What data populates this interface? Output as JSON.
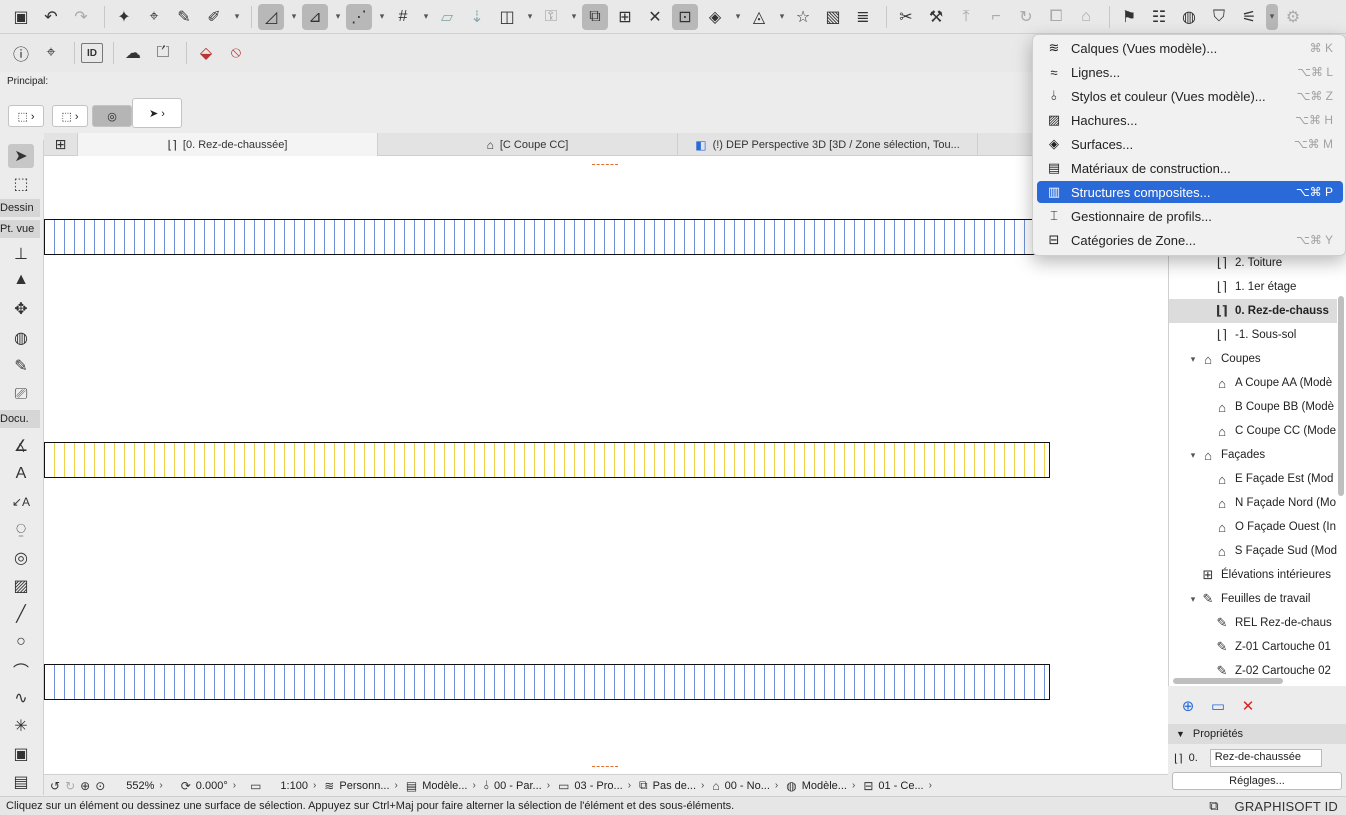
{
  "colors": {
    "menu_highlight": "#2a6ad8",
    "wall_hatch_blue": "#6e8fd8",
    "wall_hatch_yellow": "#f0d24a",
    "marker_orange": "#e07030"
  },
  "principal": {
    "label": "Principal:"
  },
  "toolbox": {
    "groups": {
      "dessin": "Dessin",
      "pt_vue": "Pt. vue",
      "docu": "Docu."
    }
  },
  "tabs": [
    {
      "label": "[0. Rez-de-chaussée]",
      "icon": "floor-plan-icon"
    },
    {
      "label": "[C Coupe CC]",
      "icon": "section-icon"
    },
    {
      "label": "(!) DEP Perspective 3D [3D / Zone sélection, Tou...",
      "icon": "3d-icon"
    }
  ],
  "navigator": {
    "items": [
      {
        "label": "2. Toiture",
        "icon": "floor-plan-icon"
      },
      {
        "label": "1. 1er étage",
        "icon": "floor-plan-icon"
      },
      {
        "label": "0. Rez-de-chauss",
        "icon": "floor-plan-icon"
      },
      {
        "label": "-1. Sous-sol",
        "icon": "floor-plan-icon"
      },
      {
        "label": "Coupes",
        "icon": "section-icon"
      },
      {
        "label": "A Coupe AA (Modè",
        "icon": "section-icon"
      },
      {
        "label": "B Coupe BB (Modè",
        "icon": "section-icon"
      },
      {
        "label": "C Coupe CC (Mode",
        "icon": "section-icon"
      },
      {
        "label": "Façades",
        "icon": "elevation-icon"
      },
      {
        "label": "E Façade Est (Mod",
        "icon": "elevation-icon"
      },
      {
        "label": "N Façade Nord (Mo",
        "icon": "elevation-icon"
      },
      {
        "label": "O Façade Ouest (In",
        "icon": "elevation-icon"
      },
      {
        "label": "S Façade Sud (Mod",
        "icon": "elevation-icon"
      },
      {
        "label": "Élévations intérieures",
        "icon": "interior-elevation-icon"
      },
      {
        "label": "Feuilles de travail",
        "icon": "worksheet-icon"
      },
      {
        "label": "REL Rez-de-chaus",
        "icon": "worksheet-icon"
      },
      {
        "label": "Z-01 Cartouche 01",
        "icon": "worksheet-icon"
      },
      {
        "label": "Z-02 Cartouche 02",
        "icon": "worksheet-icon"
      }
    ]
  },
  "properties": {
    "header": "Propriétés",
    "story_number": "0.",
    "story_name": "Rez-de-chaussée",
    "settings_button": "Réglages..."
  },
  "bottombar": {
    "zoom": "552%",
    "angle": "0.000°",
    "scale": "1:100",
    "layer_combo": "Personn...",
    "model_view": "Modèle...",
    "pen_set": "00 - Par...",
    "renovation": "03 - Pro...",
    "structure": "Pas de...",
    "dimension": "00 - No...",
    "model_view2": "Modèle...",
    "sheet": "01 - Ce..."
  },
  "status": {
    "text": "Cliquez sur un élément ou dessinez une surface de sélection. Appuyez sur Ctrl+Maj pour faire alterner la sélection de l'élément et des sous-éléments.",
    "brand": "GRAPHISOFT ID"
  },
  "menu": {
    "items": [
      {
        "label": "Calques (Vues modèle)...",
        "shortcut": "⌘ K",
        "icon": "layers-icon"
      },
      {
        "label": "Lignes...",
        "shortcut": "⌥⌘ L",
        "icon": "lines-icon"
      },
      {
        "label": "Stylos et couleur (Vues modèle)...",
        "shortcut": "⌥⌘ Z",
        "icon": "pen-icon"
      },
      {
        "label": "Hachures...",
        "shortcut": "⌥⌘ H",
        "icon": "hatch-icon"
      },
      {
        "label": "Surfaces...",
        "shortcut": "⌥⌘ M",
        "icon": "surfaces-icon"
      },
      {
        "label": "Matériaux de construction...",
        "shortcut": "",
        "icon": "building-materials-icon"
      },
      {
        "label": "Structures composites...",
        "shortcut": "⌥⌘ P",
        "icon": "composite-icon"
      },
      {
        "label": "Gestionnaire de profils...",
        "shortcut": "",
        "icon": "profile-manager-icon"
      },
      {
        "label": "Catégories de Zone...",
        "shortcut": "⌥⌘ Y",
        "icon": "zone-category-icon"
      }
    ]
  }
}
